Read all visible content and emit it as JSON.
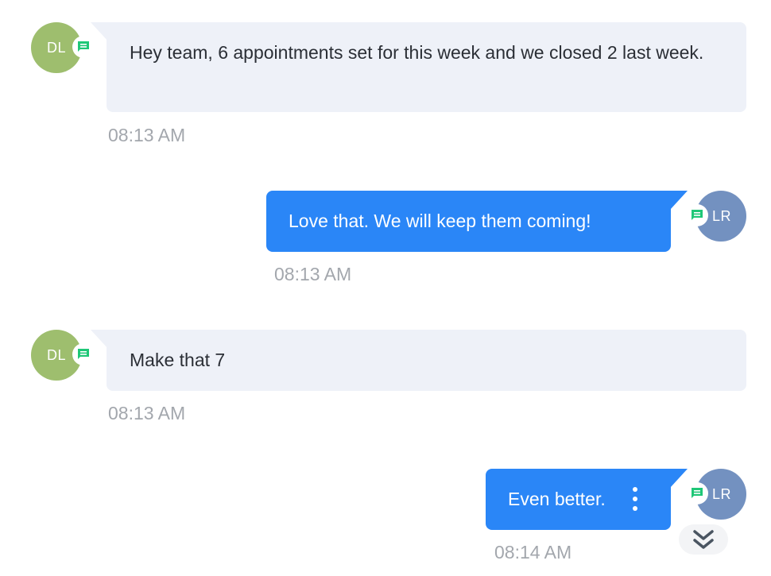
{
  "messages": [
    {
      "sender_initials": "DL",
      "direction": "incoming",
      "text": "Hey team, 6 appointments set for this week and we closed 2 last week.",
      "time": "08:13 AM",
      "avatar_color": "#9ebe6e",
      "channel_icon": "chat-message-icon"
    },
    {
      "sender_initials": "LR",
      "direction": "outgoing",
      "text": "Love that. We will keep them coming!",
      "time": "08:13 AM",
      "avatar_color": "#7391c0",
      "channel_icon": "chat-message-icon"
    },
    {
      "sender_initials": "DL",
      "direction": "incoming",
      "text": "Make that 7",
      "time": "08:13 AM",
      "avatar_color": "#9ebe6e",
      "channel_icon": "chat-message-icon"
    },
    {
      "sender_initials": "LR",
      "direction": "outgoing",
      "text": "Even better.",
      "time": "08:14 AM",
      "avatar_color": "#7391c0",
      "channel_icon": "chat-message-icon"
    }
  ],
  "message_actions": {
    "icon": "more-vertical-icon"
  },
  "scroll_to_bottom": {
    "icon": "double-chevron-down-icon"
  },
  "colors": {
    "incoming_bubble": "#eef1f8",
    "outgoing_bubble": "#2a86f7",
    "channel_icon_green": "#1fc777",
    "timestamp": "#a3a7ad"
  }
}
